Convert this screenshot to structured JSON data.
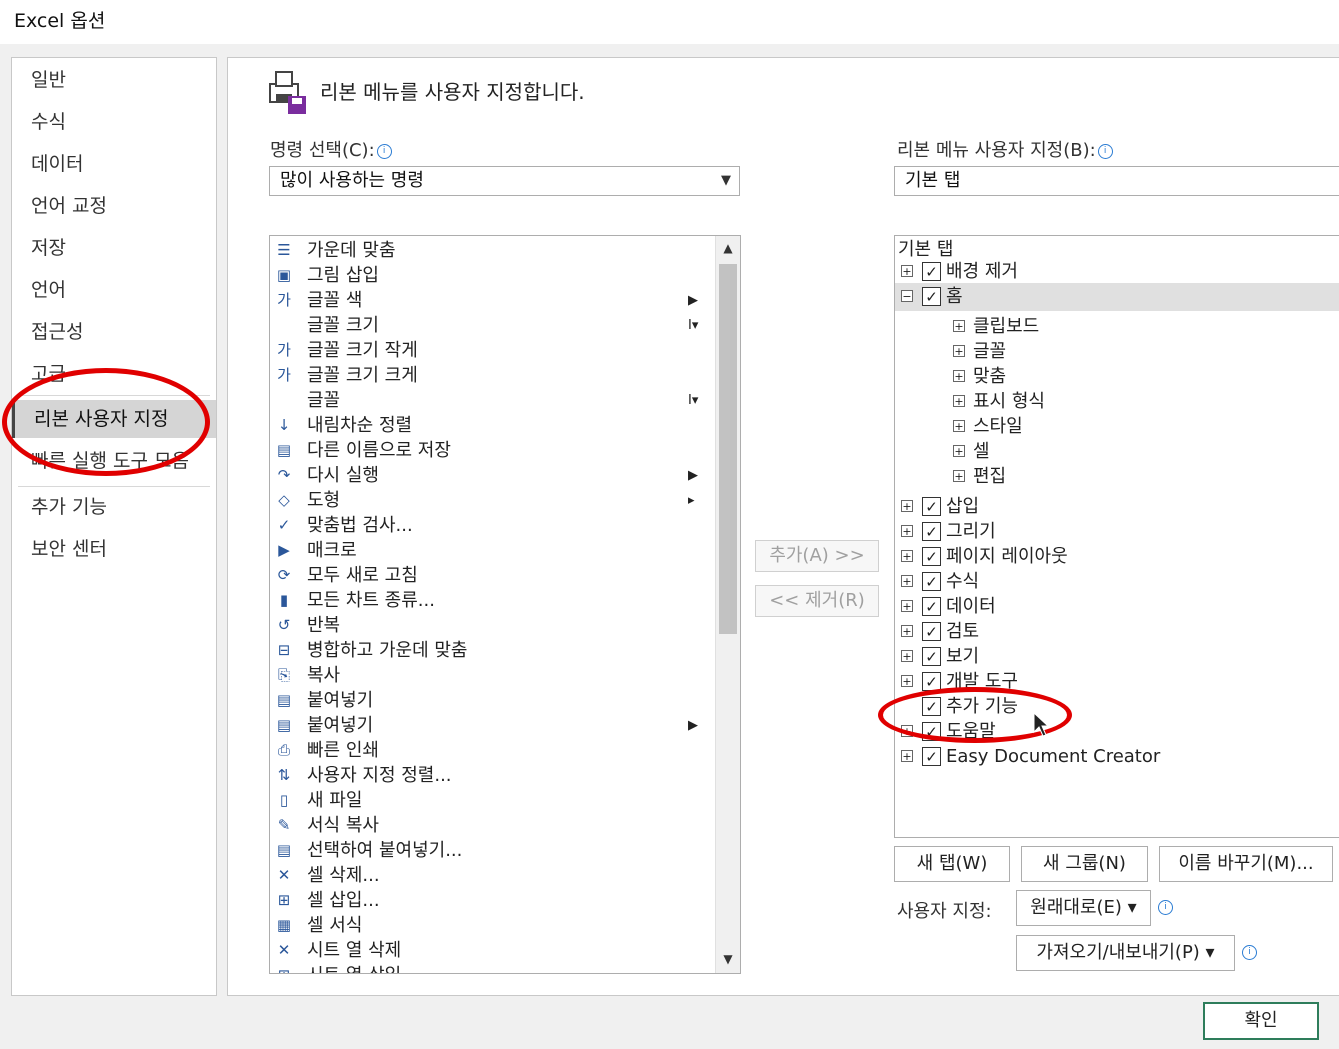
{
  "window": {
    "title": "Excel 옵션"
  },
  "nav": {
    "items": [
      {
        "label": "일반"
      },
      {
        "label": "수식"
      },
      {
        "label": "데이터"
      },
      {
        "label": "언어 교정"
      },
      {
        "label": "저장"
      },
      {
        "label": "언어"
      },
      {
        "label": "접근성"
      },
      {
        "label": "고급"
      },
      {
        "label": "리본 사용자 지정",
        "selected": true
      },
      {
        "label": "빠른 실행 도구 모음"
      },
      {
        "label": "추가 기능"
      },
      {
        "label": "보안 센터"
      }
    ]
  },
  "main": {
    "heading": "리본 메뉴를 사용자 지정합니다.",
    "choose_label": "명령 선택(C):",
    "choose_value": "많이 사용하는 명령",
    "customize_label": "리본 메뉴 사용자 지정(B):",
    "customize_value": "기본 탭",
    "commands": [
      {
        "icon": "align-center-icon",
        "glyph": "☰",
        "label": "가운데 맞춤"
      },
      {
        "icon": "insert-picture-icon",
        "glyph": "▣",
        "label": "그림 삽입"
      },
      {
        "icon": "font-color-icon",
        "glyph": "가",
        "label": "글꼴 색",
        "sub": "▶"
      },
      {
        "icon": "font-size-icon",
        "glyph": "",
        "label": "글꼴 크기",
        "sub": "Ⅰ▾"
      },
      {
        "icon": "decrease-font-icon",
        "glyph": "가",
        "label": "글꼴 크기 작게"
      },
      {
        "icon": "increase-font-icon",
        "glyph": "가",
        "label": "글꼴 크기 크게"
      },
      {
        "icon": "font-icon",
        "glyph": "",
        "label": "글꼴",
        "sub": "Ⅰ▾"
      },
      {
        "icon": "sort-descending-icon",
        "glyph": "↓",
        "label": "내림차순 정렬"
      },
      {
        "icon": "save-as-icon",
        "glyph": "▤",
        "label": "다른 이름으로 저장"
      },
      {
        "icon": "redo-icon",
        "glyph": "↷",
        "label": "다시 실행",
        "sub": "▶"
      },
      {
        "icon": "shapes-icon",
        "glyph": "◇",
        "label": "도형",
        "sub": "▸"
      },
      {
        "icon": "spelling-icon",
        "glyph": "✓",
        "label": "맞춤법 검사..."
      },
      {
        "icon": "macro-icon",
        "glyph": "▶",
        "label": "매크로"
      },
      {
        "icon": "refresh-all-icon",
        "glyph": "⟳",
        "label": "모두 새로 고침"
      },
      {
        "icon": "all-charts-icon",
        "glyph": "▮",
        "label": "모든 차트 종류..."
      },
      {
        "icon": "repeat-icon",
        "glyph": "↺",
        "label": "반복"
      },
      {
        "icon": "merge-center-icon",
        "glyph": "⊟",
        "label": "병합하고 가운데 맞춤"
      },
      {
        "icon": "copy-icon",
        "glyph": "⎘",
        "label": "복사"
      },
      {
        "icon": "paste-icon",
        "glyph": "▤",
        "label": "붙여넣기"
      },
      {
        "icon": "paste-icon",
        "glyph": "▤",
        "label": "붙여넣기",
        "sub": "▶"
      },
      {
        "icon": "quick-print-icon",
        "glyph": "⎙",
        "label": "빠른 인쇄"
      },
      {
        "icon": "custom-sort-icon",
        "glyph": "⇅",
        "label": "사용자 지정 정렬..."
      },
      {
        "icon": "new-file-icon",
        "glyph": "▯",
        "label": "새 파일"
      },
      {
        "icon": "format-painter-icon",
        "glyph": "✎",
        "label": "서식 복사"
      },
      {
        "icon": "paste-special-icon",
        "glyph": "▤",
        "label": "선택하여 붙여넣기..."
      },
      {
        "icon": "delete-cells-icon",
        "glyph": "✕",
        "label": "셀 삭제..."
      },
      {
        "icon": "insert-cells-icon",
        "glyph": "⊞",
        "label": "셀 삽입..."
      },
      {
        "icon": "format-cells-icon",
        "glyph": "▦",
        "label": "셀 서식"
      },
      {
        "icon": "delete-sheet-columns-icon",
        "glyph": "✕",
        "label": "시트 열 삭제"
      },
      {
        "icon": "insert-sheet-columns-icon",
        "glyph": "⊞",
        "label": "시트 열 삽입"
      }
    ],
    "add_button": "추가(A) >>",
    "remove_button": "<< 제거(R)",
    "tree_header": "기본 탭",
    "tree": [
      {
        "level": 0,
        "expander": "+",
        "checked": true,
        "label": "배경 제거"
      },
      {
        "level": 0,
        "expander": "−",
        "checked": true,
        "label": "홈",
        "highlight": true
      },
      {
        "level": 1,
        "expander": "+",
        "label": "클립보드"
      },
      {
        "level": 1,
        "expander": "+",
        "label": "글꼴"
      },
      {
        "level": 1,
        "expander": "+",
        "label": "맞춤"
      },
      {
        "level": 1,
        "expander": "+",
        "label": "표시 형식"
      },
      {
        "level": 1,
        "expander": "+",
        "label": "스타일"
      },
      {
        "level": 1,
        "expander": "+",
        "label": "셀"
      },
      {
        "level": 1,
        "expander": "+",
        "label": "편집"
      },
      {
        "level": 0,
        "expander": "+",
        "checked": true,
        "label": "삽입"
      },
      {
        "level": 0,
        "expander": "+",
        "checked": true,
        "label": "그리기"
      },
      {
        "level": 0,
        "expander": "+",
        "checked": true,
        "label": "페이지 레이아웃"
      },
      {
        "level": 0,
        "expander": "+",
        "checked": true,
        "label": "수식"
      },
      {
        "level": 0,
        "expander": "+",
        "checked": true,
        "label": "데이터"
      },
      {
        "level": 0,
        "expander": "+",
        "checked": true,
        "label": "검토"
      },
      {
        "level": 0,
        "expander": "+",
        "checked": true,
        "label": "보기"
      },
      {
        "level": 0,
        "expander": "+",
        "checked": true,
        "label": "개발 도구"
      },
      {
        "level": 0,
        "expander": "",
        "checked": true,
        "label": "추가 기능"
      },
      {
        "level": 0,
        "expander": "+",
        "checked": true,
        "label": "도움말"
      },
      {
        "level": 0,
        "expander": "+",
        "checked": true,
        "label": "Easy Document Creator"
      }
    ],
    "new_tab_button": "새 탭(W)",
    "new_group_button": "새 그룹(N)",
    "rename_button": "이름 바꾸기(M)...",
    "customizations_label": "사용자 지정:",
    "reset_button": "원래대로(E) ▾",
    "import_export_button": "가져오기/내보내기(P) ▾"
  },
  "footer": {
    "ok_button": "확인"
  },
  "colors": {
    "annotation": "#e00000",
    "nav_selected": "#d5d5d5"
  }
}
